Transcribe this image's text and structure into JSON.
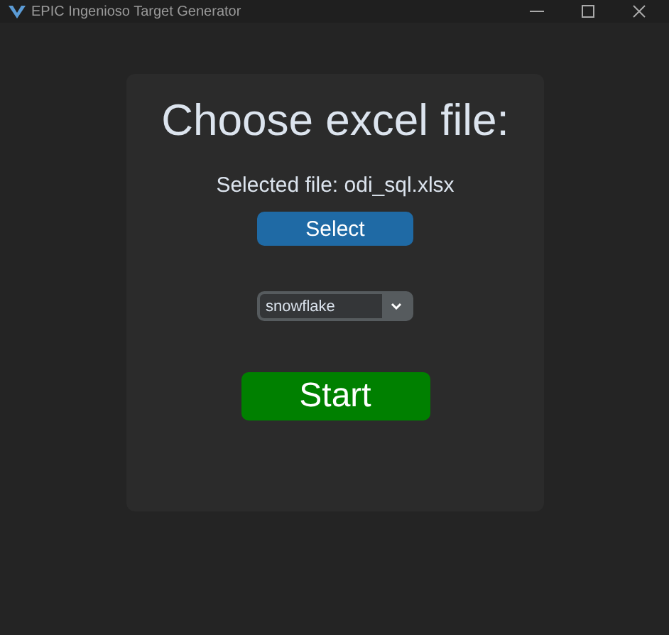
{
  "window": {
    "title": "EPIC Ingenioso Target Generator"
  },
  "heading": "Choose excel file:",
  "selected_file": "Selected file: odi_sql.xlsx",
  "select_button": "Select",
  "dropdown": {
    "value": "snowflake"
  },
  "start_button": "Start"
}
